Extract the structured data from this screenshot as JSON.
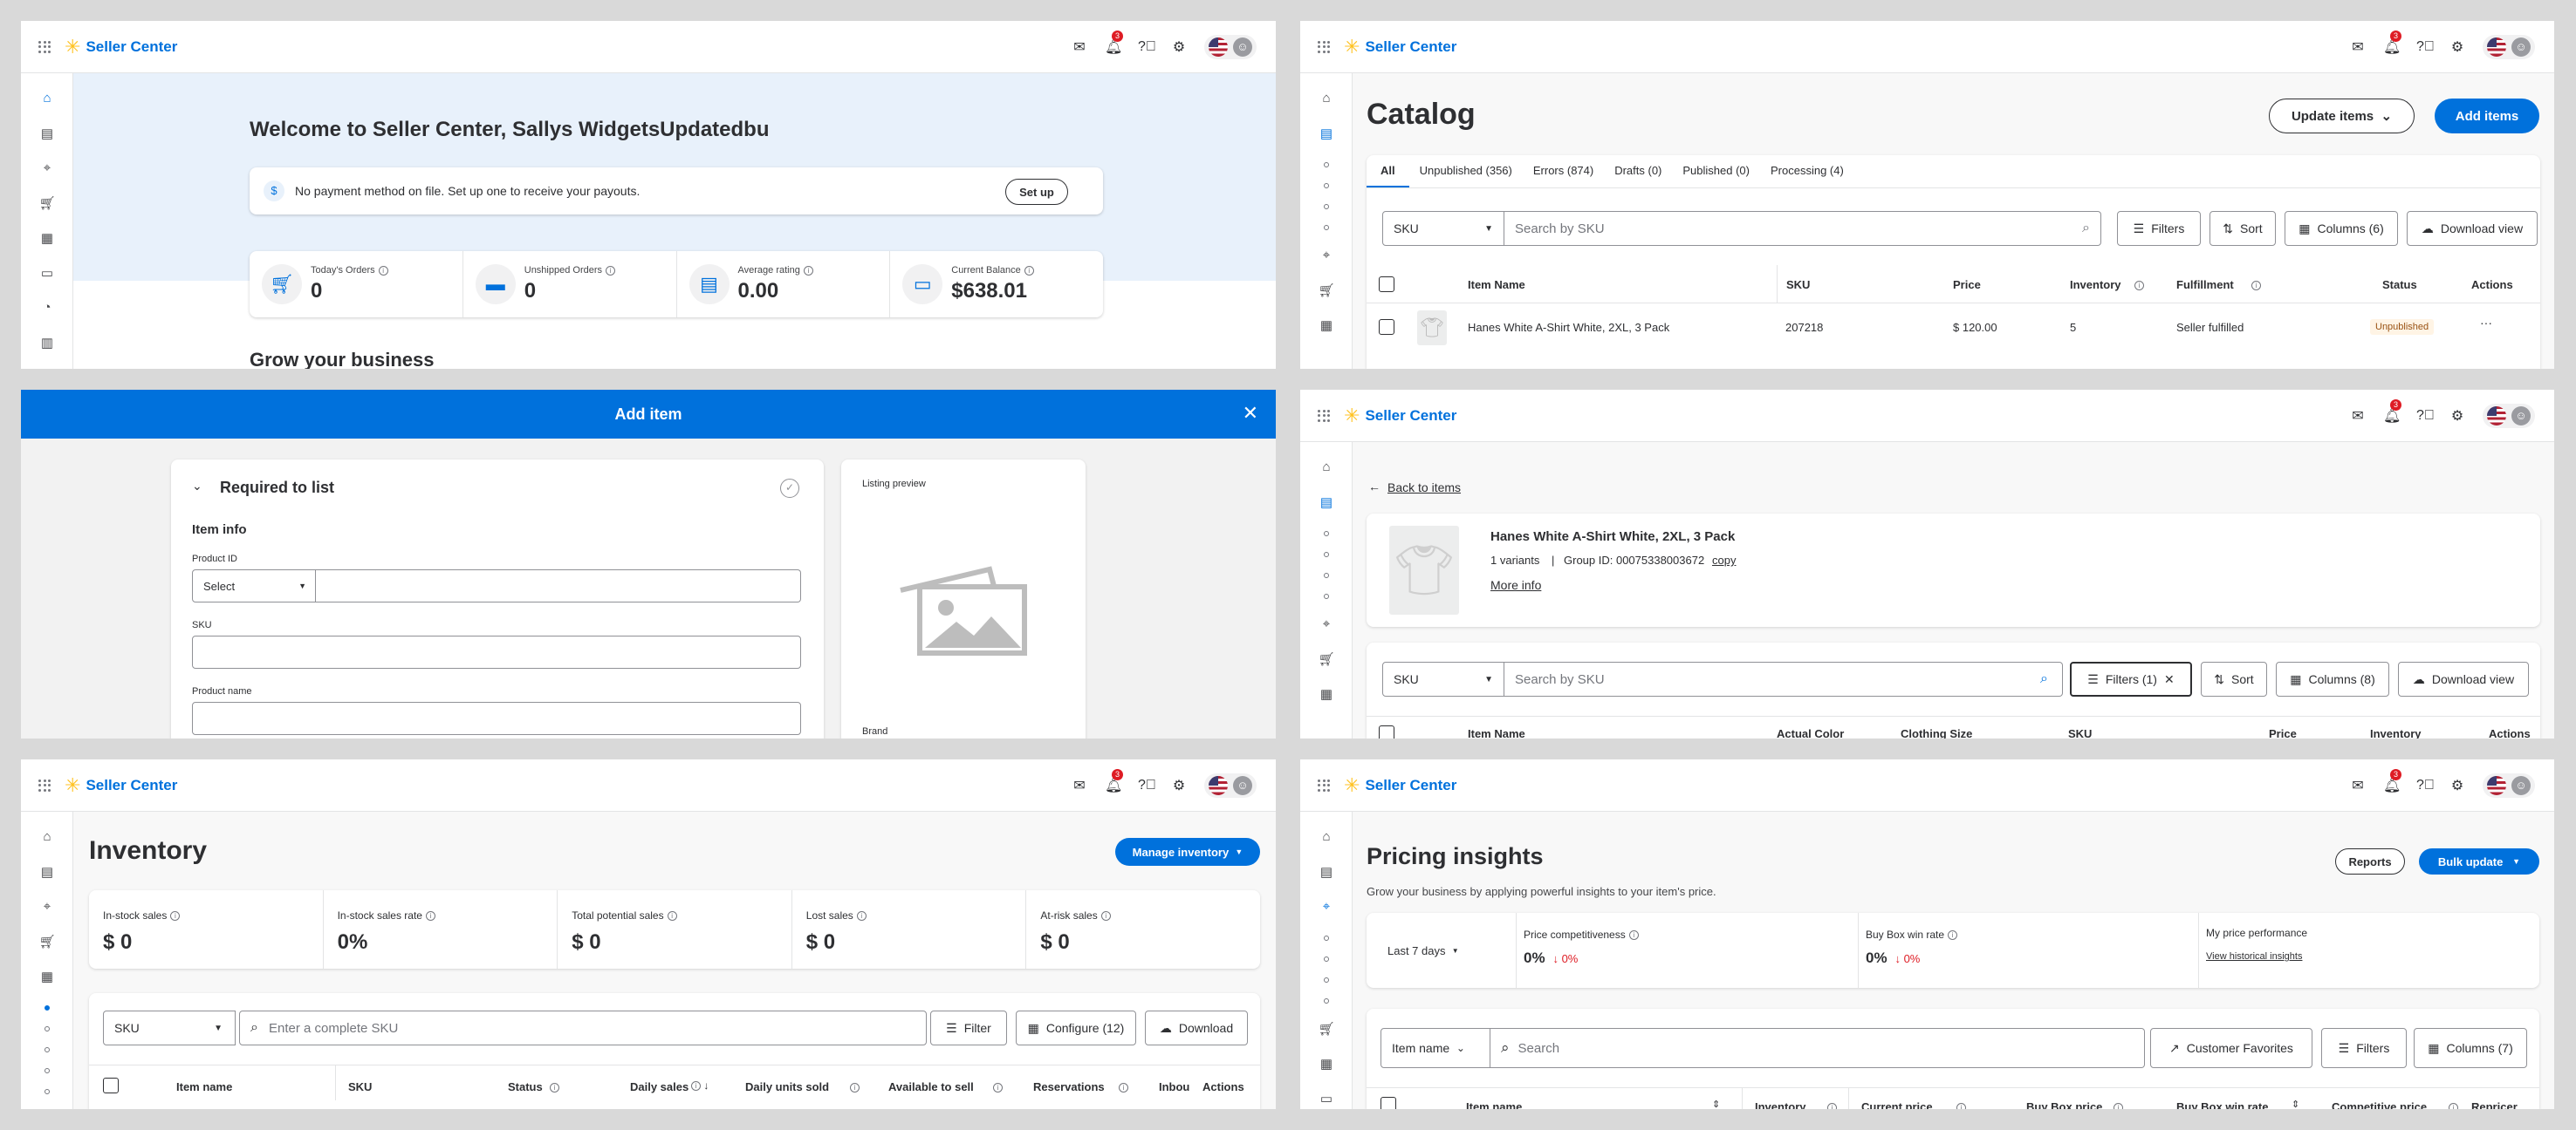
{
  "header": {
    "brand": "Seller Center",
    "notif_count": "3"
  },
  "p1": {
    "welcome": "Welcome to Seller Center, Sallys WidgetsUpdatedbu",
    "payment_icon": "$",
    "payment_msg": "No payment method on file. Set up one to receive your payouts.",
    "setup_label": "Set up",
    "stats": [
      {
        "label": "Today's Orders",
        "value": "0"
      },
      {
        "label": "Unshipped Orders",
        "value": "0"
      },
      {
        "label": "Average rating",
        "value": "0.00"
      },
      {
        "label": "Current Balance",
        "value": "$638.01"
      }
    ],
    "grow": "Grow your business"
  },
  "p2": {
    "title": "Catalog",
    "update_items": "Update items",
    "add_items": "Add items",
    "tabs": [
      "All",
      "Unpublished (356)",
      "Errors (874)",
      "Drafts (0)",
      "Published (0)",
      "Processing (4)"
    ],
    "sku_select": "SKU",
    "search_placeholder": "Search by SKU",
    "filters": "Filters",
    "sort": "Sort",
    "columns": "Columns (6)",
    "download": "Download view",
    "headers": [
      "Item Name",
      "SKU",
      "Price",
      "Inventory",
      "Fulfillment",
      "Status",
      "Actions"
    ],
    "row": {
      "name": "Hanes White A-Shirt White, 2XL, 3 Pack",
      "sku": "207218",
      "price": "$ 120.00",
      "inventory": "5",
      "fulfillment": "Seller fulfilled",
      "status": "Unpublished",
      "actions": "···"
    }
  },
  "p3": {
    "title": "Add item",
    "close": "✕",
    "section": "Required to list",
    "item_info": "Item info",
    "product_id_label": "Product ID",
    "select": "Select",
    "sku_label": "SKU",
    "product_name_label": "Product name",
    "listing_preview": "Listing preview",
    "brand": "Brand"
  },
  "p4": {
    "back": "Back to items",
    "product_title": "Hanes White A-Shirt White, 2XL, 3 Pack",
    "variants": "1 variants",
    "group_id": "Group ID: 00075338003672",
    "copy": "copy",
    "more_info": "More info",
    "sku_select": "SKU",
    "search_placeholder": "Search by SKU",
    "filters": "Filters (1)",
    "sort": "Sort",
    "columns": "Columns (8)",
    "download": "Download view",
    "headers": [
      "Item Name",
      "Actual Color",
      "Clothing Size",
      "SKU",
      "Price",
      "Inventory",
      "Actions"
    ]
  },
  "p5": {
    "title": "Inventory",
    "manage": "Manage inventory",
    "stats": [
      {
        "label": "In-stock sales",
        "value": "$ 0"
      },
      {
        "label": "In-stock sales rate",
        "value": "0%"
      },
      {
        "label": "Total potential sales",
        "value": "$ 0"
      },
      {
        "label": "Lost sales",
        "value": "$ 0"
      },
      {
        "label": "At-risk sales",
        "value": "$ 0"
      }
    ],
    "sku_select": "SKU",
    "search_placeholder": "Enter a complete SKU",
    "filter": "Filter",
    "configure": "Configure (12)",
    "download": "Download",
    "headers": [
      "Item name",
      "SKU",
      "Status",
      "Daily sales",
      "Daily units sold",
      "Available to sell",
      "Reservations",
      "Inbou",
      "Actions"
    ]
  },
  "p6": {
    "title": "Pricing insights",
    "subtitle": "Grow your business by applying powerful insights to your item's price.",
    "reports": "Reports",
    "bulk_update": "Bulk update",
    "range": "Last 7 days",
    "metrics": [
      {
        "label": "Price competitiveness",
        "value": "0%",
        "delta": "↓ 0%"
      },
      {
        "label": "Buy Box win rate",
        "value": "0%",
        "delta": "↓ 0%"
      }
    ],
    "perf_label": "My price performance",
    "perf_link": "View historical insights",
    "item_name_select": "Item name",
    "search_placeholder": "Search",
    "customer_fav": "Customer Favorites",
    "filters": "Filters",
    "columns": "Columns (7)",
    "headers": [
      "Item name",
      "Inventory",
      "Current price",
      "Buy Box price",
      "Buy Box win rate",
      "Competitive price",
      "Repricer"
    ]
  }
}
